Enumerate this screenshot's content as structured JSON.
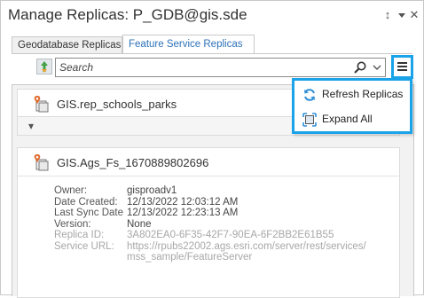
{
  "window": {
    "title": "Manage Replicas: P_GDB@gis.sde",
    "pin_icon": "pin-icon",
    "close_icon": "close-icon",
    "pin_glyph": "↕",
    "close_glyph": "✕"
  },
  "tabs": [
    {
      "label": "Geodatabase Replicas",
      "active": false
    },
    {
      "label": "Feature Service Replicas",
      "active": true
    }
  ],
  "toolbar": {
    "search_placeholder": "Search",
    "search_value": "",
    "search_icon": "search-icon",
    "dropdown_icon": "chevron-down-icon",
    "menu_icon": "hamburger-menu-icon"
  },
  "replicas": [
    {
      "name": "GIS.rep_schools_parks",
      "icon": "replica-icon"
    },
    {
      "name": "GIS.Ags_Fs_1670889802696",
      "icon": "replica-icon",
      "properties": [
        {
          "label": "Owner:",
          "value": "gisproadv1"
        },
        {
          "label": "Date Created:",
          "value": "12/13/2022 12:03:12 AM"
        },
        {
          "label": "Last Sync Date",
          "value": "12/13/2022 12:23:13 AM"
        },
        {
          "label": "Version:",
          "value": "None"
        },
        {
          "label": "Replica ID:",
          "value": "3A802EA0-6F35-42F7-90EA-6F2BB2E61B55"
        },
        {
          "label": "Service URL:",
          "value": "https://rpubs22002.ags.esri.com/server/rest/services/"
        },
        {
          "label": "",
          "value": "mss_sample/FeatureServer"
        }
      ]
    }
  ],
  "expander": {
    "icon": "chevron-down-icon",
    "glyph": "▾"
  },
  "flyout_menu": {
    "items": [
      {
        "label": "Refresh Replicas",
        "icon": "refresh-icon"
      },
      {
        "label": "Expand All",
        "icon": "expand-icon"
      }
    ]
  },
  "colors": {
    "accent": "#1aa3e8",
    "tab_active_text": "#2e72b8",
    "background": "#f2f2f2"
  }
}
